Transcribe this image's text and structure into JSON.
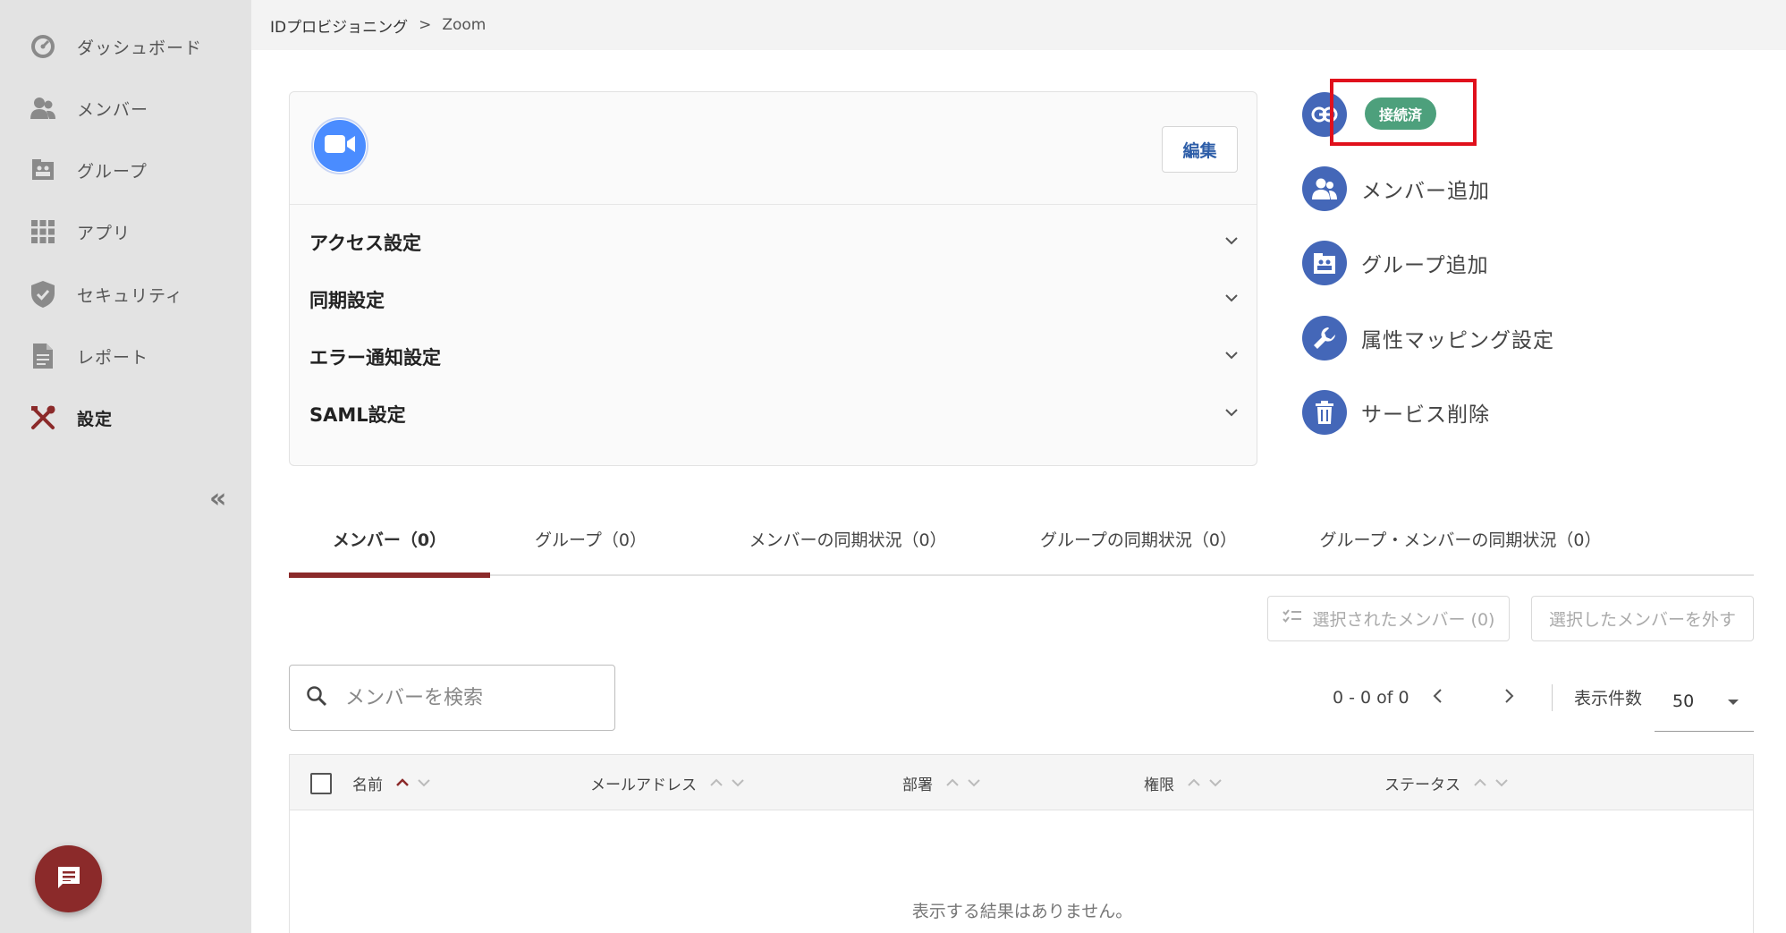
{
  "sidebar": {
    "items": [
      {
        "label": "ダッシュボード",
        "icon": "dashboard-icon"
      },
      {
        "label": "メンバー",
        "icon": "members-icon"
      },
      {
        "label": "グループ",
        "icon": "group-icon"
      },
      {
        "label": "アプリ",
        "icon": "apps-grid-icon"
      },
      {
        "label": "セキュリティ",
        "icon": "shield-icon"
      },
      {
        "label": "レポート",
        "icon": "report-icon"
      },
      {
        "label": "設定",
        "icon": "tools-icon",
        "active": true
      }
    ],
    "collapse_label": "«"
  },
  "breadcrumb": {
    "parent": "IDプロビジョニング",
    "separator": ">",
    "current": "Zoom"
  },
  "service_card": {
    "logo_icon": "zoom-camera-icon",
    "edit_label": "編集",
    "sections": [
      {
        "label": "アクセス設定"
      },
      {
        "label": "同期設定"
      },
      {
        "label": "エラー通知設定"
      },
      {
        "label": "SAML設定"
      }
    ]
  },
  "actions": {
    "status_label": "接続済",
    "add_member": "メンバー追加",
    "add_group": "グループ追加",
    "attribute_mapping": "属性マッピング設定",
    "delete_service": "サービス削除"
  },
  "tabs": [
    {
      "label": "メンバー（0）",
      "active": true
    },
    {
      "label": "グループ（0）"
    },
    {
      "label": "メンバーの同期状況（0）"
    },
    {
      "label": "グループの同期状況（0）"
    },
    {
      "label": "グループ・メンバーの同期状況（0）"
    }
  ],
  "toolbar": {
    "selected_members": "選択されたメンバー (0)",
    "remove_selected": "選択したメンバーを外す"
  },
  "search": {
    "placeholder": "メンバーを検索"
  },
  "pagination": {
    "range": "0 - 0 of 0",
    "per_page_label": "表示件数",
    "per_page_value": "50"
  },
  "table": {
    "columns": [
      "名前",
      "メールアドレス",
      "部署",
      "権限",
      "ステータス"
    ],
    "empty_message": "表示する結果はありません。"
  },
  "colors": {
    "accent": "#8b2a2a",
    "action_blue": "#4467b8",
    "status_green": "#4da07c",
    "highlight_red": "#e0101c"
  }
}
